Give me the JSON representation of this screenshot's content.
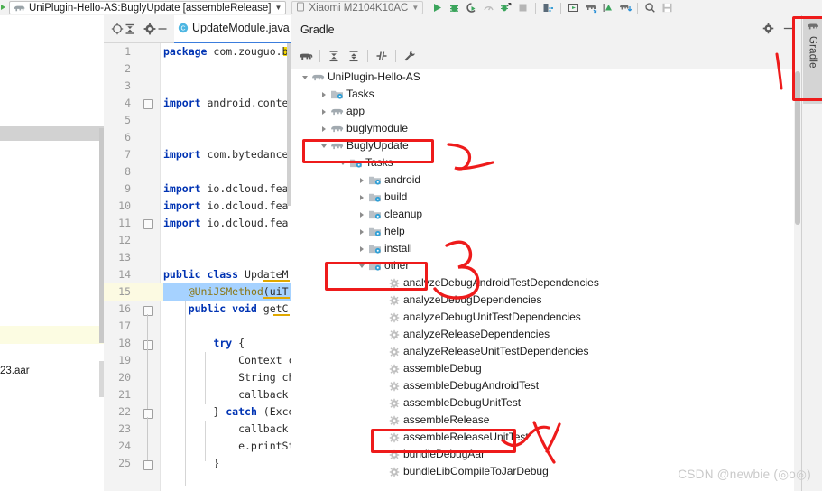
{
  "window": {
    "run_config": "UniPlugin-Hello-AS:BuglyUpdate [assembleRelease]",
    "device": "Xiaomi M2104K10AC",
    "toolbar_icons": [
      "run-icon",
      "debug-icon",
      "run-coverage-icon",
      "profiler-icon",
      "attach-debugger-icon",
      "stop-icon",
      "avd-manager-icon",
      "sdk-manager-icon",
      "sync-gradle-icon",
      "upload-icon",
      "download-icon",
      "search-icon",
      "save-icon"
    ]
  },
  "editor": {
    "toolbar_icons": [
      "locate-file-icon",
      "collapse-all-icon",
      "settings-gear-icon",
      "hide-panel-icon"
    ],
    "tab": {
      "label": "UpdateModule.java",
      "file_type": "C",
      "close": "×",
      "overflow": "⌄"
    },
    "lines": [
      {
        "n": "1",
        "text": "package com.zouguo.b",
        "kind": "kw-first",
        "kw": "package"
      },
      {
        "n": "2",
        "text": "",
        "kind": "plain"
      },
      {
        "n": "3",
        "text": "",
        "kind": "plain"
      },
      {
        "n": "4",
        "text": "import android.conte",
        "kind": "kw-first",
        "kw": "import"
      },
      {
        "n": "5",
        "text": "",
        "kind": "plain"
      },
      {
        "n": "6",
        "text": "",
        "kind": "plain"
      },
      {
        "n": "7",
        "text": "import com.bytedance",
        "kind": "kw-first",
        "kw": "import"
      },
      {
        "n": "8",
        "text": "",
        "kind": "plain"
      },
      {
        "n": "9",
        "text": "import io.dcloud.fea",
        "kind": "kw-first",
        "kw": "import"
      },
      {
        "n": "10",
        "text": "import io.dcloud.fea",
        "kind": "kw-first",
        "kw": "import"
      },
      {
        "n": "11",
        "text": "import io.dcloud.fea",
        "kind": "kw-first",
        "kw": "import"
      },
      {
        "n": "12",
        "text": "",
        "kind": "plain"
      },
      {
        "n": "13",
        "text": "",
        "kind": "plain"
      },
      {
        "n": "14",
        "text": "public class UpdateM",
        "kind": "kw-class"
      },
      {
        "n": "15",
        "text": "    @UniJSMethod(uiT",
        "kind": "annotation"
      },
      {
        "n": "16",
        "text": "    public void getC",
        "kind": "kw-method"
      },
      {
        "n": "17",
        "text": "",
        "kind": "plain"
      },
      {
        "n": "18",
        "text": "        try {",
        "kind": "kw-try"
      },
      {
        "n": "19",
        "text": "            Context c",
        "kind": "plain"
      },
      {
        "n": "20",
        "text": "            String ch",
        "kind": "plain"
      },
      {
        "n": "21",
        "text": "            callback.",
        "kind": "plain"
      },
      {
        "n": "22",
        "text": "        } catch (Exce",
        "kind": "kw-catch"
      },
      {
        "n": "23",
        "text": "            callback.",
        "kind": "plain"
      },
      {
        "n": "24",
        "text": "            e.printSt",
        "kind": "plain"
      },
      {
        "n": "25",
        "text": "        }",
        "kind": "plain"
      }
    ]
  },
  "left_panel": {
    "file_label": "23.aar"
  },
  "gradle": {
    "title": "Gradle",
    "header_icons": [
      "settings-gear-icon",
      "hide-panel-icon"
    ],
    "toolbar_icons": [
      "execute-gradle-task-icon",
      "expand-all-icon",
      "collapse-all-icon",
      "toggle-offline-mode-icon",
      "gradle-settings-icon"
    ],
    "tree": [
      {
        "label": "UniPlugin-Hello-AS",
        "depth": 0,
        "state": "expanded",
        "icon": "gradle-elephant-icon"
      },
      {
        "label": "Tasks",
        "depth": 1,
        "state": "collapsed",
        "icon": "tasks-folder-icon"
      },
      {
        "label": "app",
        "depth": 1,
        "state": "collapsed",
        "icon": "gradle-elephant-icon"
      },
      {
        "label": "buglymodule",
        "depth": 1,
        "state": "collapsed",
        "icon": "gradle-elephant-icon"
      },
      {
        "label": "BuglyUpdate",
        "depth": 1,
        "state": "expanded",
        "icon": "gradle-elephant-icon"
      },
      {
        "label": "Tasks",
        "depth": 2,
        "state": "expanded",
        "icon": "tasks-folder-icon"
      },
      {
        "label": "android",
        "depth": 3,
        "state": "collapsed",
        "icon": "tasks-folder-icon"
      },
      {
        "label": "build",
        "depth": 3,
        "state": "collapsed",
        "icon": "tasks-folder-icon"
      },
      {
        "label": "cleanup",
        "depth": 3,
        "state": "collapsed",
        "icon": "tasks-folder-icon"
      },
      {
        "label": "help",
        "depth": 3,
        "state": "collapsed",
        "icon": "tasks-folder-icon"
      },
      {
        "label": "install",
        "depth": 3,
        "state": "collapsed",
        "icon": "tasks-folder-icon"
      },
      {
        "label": "other",
        "depth": 3,
        "state": "expanded",
        "icon": "tasks-folder-icon"
      },
      {
        "label": "analyzeDebugAndroidTestDependencies",
        "depth": 4,
        "state": "leaf",
        "icon": "gradle-task-gear-icon"
      },
      {
        "label": "analyzeDebugDependencies",
        "depth": 4,
        "state": "leaf",
        "icon": "gradle-task-gear-icon"
      },
      {
        "label": "analyzeDebugUnitTestDependencies",
        "depth": 4,
        "state": "leaf",
        "icon": "gradle-task-gear-icon"
      },
      {
        "label": "analyzeReleaseDependencies",
        "depth": 4,
        "state": "leaf",
        "icon": "gradle-task-gear-icon"
      },
      {
        "label": "analyzeReleaseUnitTestDependencies",
        "depth": 4,
        "state": "leaf",
        "icon": "gradle-task-gear-icon"
      },
      {
        "label": "assembleDebug",
        "depth": 4,
        "state": "leaf",
        "icon": "gradle-task-gear-icon"
      },
      {
        "label": "assembleDebugAndroidTest",
        "depth": 4,
        "state": "leaf",
        "icon": "gradle-task-gear-icon"
      },
      {
        "label": "assembleDebugUnitTest",
        "depth": 4,
        "state": "leaf",
        "icon": "gradle-task-gear-icon"
      },
      {
        "label": "assembleRelease",
        "depth": 4,
        "state": "leaf",
        "icon": "gradle-task-gear-icon"
      },
      {
        "label": "assembleReleaseUnitTest",
        "depth": 4,
        "state": "leaf",
        "icon": "gradle-task-gear-icon"
      },
      {
        "label": "bundleDebugAar",
        "depth": 4,
        "state": "leaf",
        "icon": "gradle-task-gear-icon"
      },
      {
        "label": "bundleLibCompileToJarDebug",
        "depth": 4,
        "state": "leaf",
        "icon": "gradle-task-gear-icon"
      }
    ]
  },
  "right_strip": {
    "gradle_tab": "Gradle"
  },
  "annotations": {
    "color": "#ee1b1b",
    "highlighted": [
      "BuglyUpdate",
      "other",
      "assembleRelease",
      "Gradle tool window tab"
    ]
  },
  "watermark": "CSDN @newbie (◎o◎)"
}
